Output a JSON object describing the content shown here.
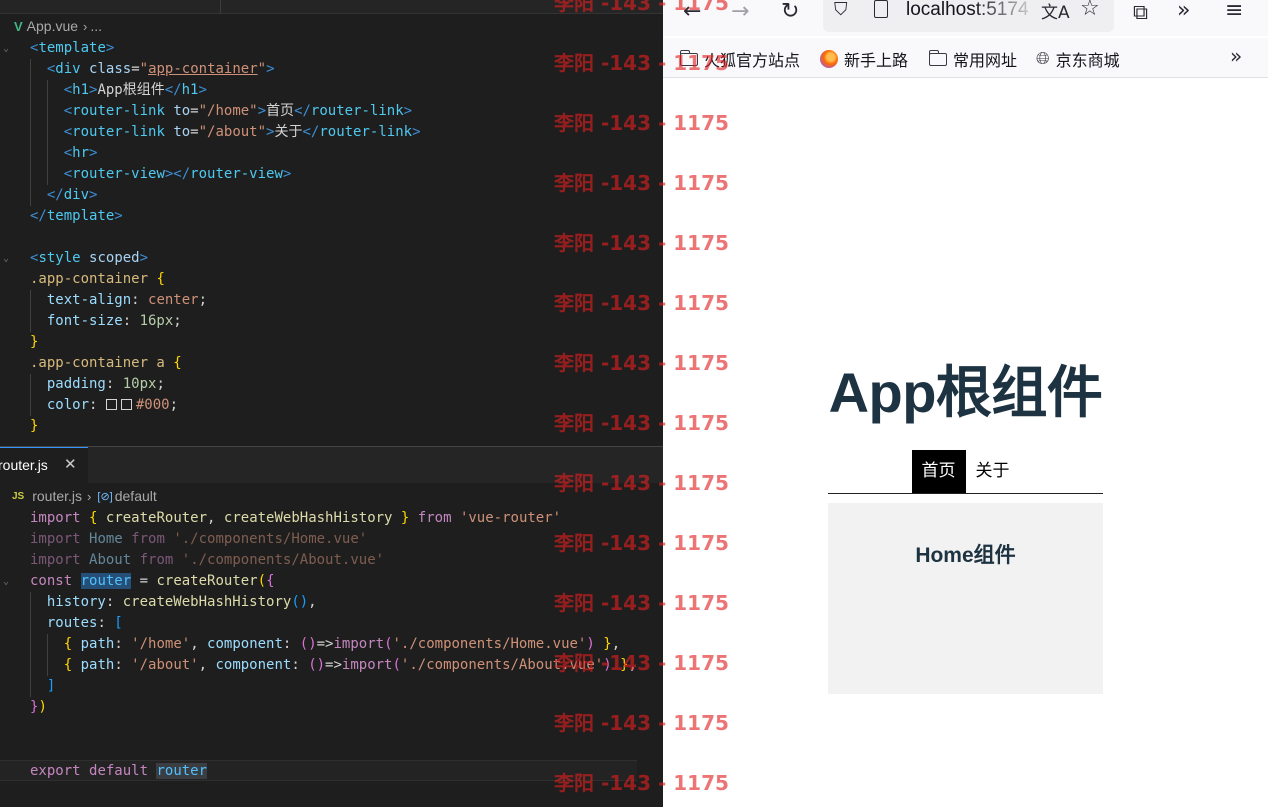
{
  "editor": {
    "top_breadcrumb": {
      "file": "App.vue",
      "rest": "..."
    },
    "bottom_tab": {
      "label": "router.js",
      "close": "✕"
    },
    "bottom_breadcrumb": {
      "file": "router.js",
      "symbol": "default"
    }
  },
  "browser": {
    "url": "localhost:5174",
    "bookmarks": [
      "火狐官方站点",
      "新手上路",
      "常用网址",
      "京东商城"
    ],
    "page": {
      "title": "App根组件",
      "links": [
        {
          "label": "首页",
          "active": true
        },
        {
          "label": "关于",
          "active": false
        }
      ],
      "view_title": "Home组件"
    }
  },
  "watermark": {
    "text": "李阳 -143 - 1175",
    "color": "#e11e1e"
  },
  "colors": {
    "editor_bg": "#1e1e1e",
    "vue_green": "#41b883",
    "selection": "#264f78",
    "title_color": "#1e3342",
    "view_bg": "#f2f2f2"
  }
}
